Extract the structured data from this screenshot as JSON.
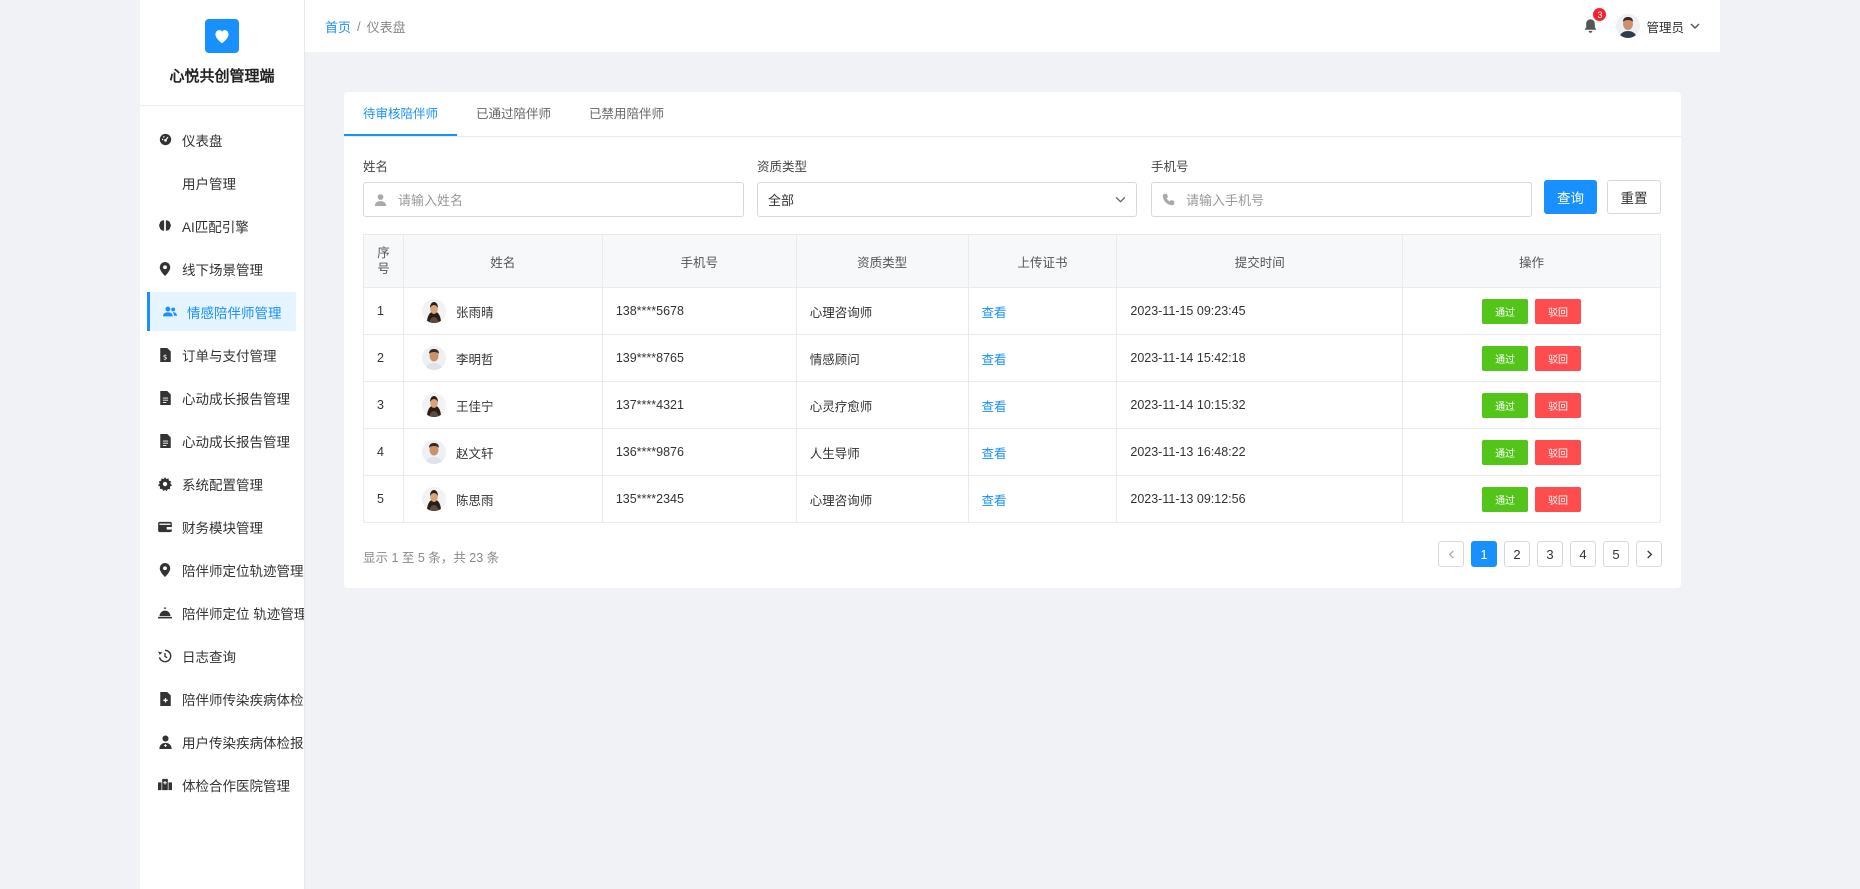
{
  "app": {
    "title": "心悦共创管理端"
  },
  "sidebar": {
    "items": [
      {
        "label": "仪表盘",
        "icon": "dashboard-icon"
      },
      {
        "label": "用户管理",
        "icon": ""
      },
      {
        "label": "AI匹配引擎",
        "icon": "brain-icon"
      },
      {
        "label": "线下场景管理",
        "icon": "map-pin-icon"
      },
      {
        "label": "情感陪伴师管理",
        "icon": "users-icon",
        "active": true
      },
      {
        "label": "订单与支付管理",
        "icon": "invoice-icon"
      },
      {
        "label": "心动成长报告管理",
        "icon": "file-icon"
      },
      {
        "label": "心动成长报告管理",
        "icon": "file-icon"
      },
      {
        "label": "系统配置管理",
        "icon": "gear-icon"
      },
      {
        "label": "财务模块管理",
        "icon": "wallet-icon"
      },
      {
        "label": "陪伴师定位轨迹管理",
        "icon": "map-pin-icon"
      },
      {
        "label": "陪伴师定位 轨迹管理",
        "icon": "bell-concierge-icon"
      },
      {
        "label": "日志查询",
        "icon": "history-icon"
      },
      {
        "label": "陪伴师传染疾病体检",
        "icon": "file-medical-icon"
      },
      {
        "label": "用户传染疾病体检报",
        "icon": "user-doctor-icon"
      },
      {
        "label": "体检合作医院管理",
        "icon": "hospital-icon"
      }
    ]
  },
  "header": {
    "breadcrumb": {
      "home": "首页",
      "separator": "/",
      "current": "仪表盘"
    },
    "notification_count": "3",
    "user_name": "管理员"
  },
  "tabs": [
    "待审核陪伴师",
    "已通过陪伴师",
    "已禁用陪伴师"
  ],
  "filters": {
    "name": {
      "label": "姓名",
      "placeholder": "请输入姓名"
    },
    "qualification": {
      "label": "资质类型",
      "value": "全部"
    },
    "phone": {
      "label": "手机号",
      "placeholder": "请输入手机号"
    },
    "query_label": "查询",
    "reset_label": "重置"
  },
  "table": {
    "headers": {
      "index": "序号",
      "name": "姓名",
      "phone": "手机号",
      "type": "资质类型",
      "cert": "上传证书",
      "time": "提交时间",
      "ops": "操作"
    },
    "view_label": "查看",
    "pass_label": "通过",
    "reject_label": "驳回",
    "rows": [
      {
        "index": "1",
        "name": "张雨晴",
        "phone": "138****5678",
        "type": "心理咨询师",
        "time": "2023-11-15 09:23:45",
        "avatar": "female"
      },
      {
        "index": "2",
        "name": "李明哲",
        "phone": "139****8765",
        "type": "情感顾问",
        "time": "2023-11-14 15:42:18",
        "avatar": "male"
      },
      {
        "index": "3",
        "name": "王佳宁",
        "phone": "137****4321",
        "type": "心灵疗愈师",
        "time": "2023-11-14 10:15:32",
        "avatar": "female"
      },
      {
        "index": "4",
        "name": "赵文轩",
        "phone": "136****9876",
        "type": "人生导师",
        "time": "2023-11-13 16:48:22",
        "avatar": "male"
      },
      {
        "index": "5",
        "name": "陈思雨",
        "phone": "135****2345",
        "type": "心理咨询师",
        "time": "2023-11-13 09:12:56",
        "avatar": "female"
      }
    ]
  },
  "pagination": {
    "summary": "显示 1 至 5 条，共 23 条",
    "pages": [
      "1",
      "2",
      "3",
      "4",
      "5"
    ],
    "current": "1"
  },
  "colors": {
    "primary": "#1890ff",
    "success": "#52c41a",
    "danger": "#ff4d4f"
  }
}
